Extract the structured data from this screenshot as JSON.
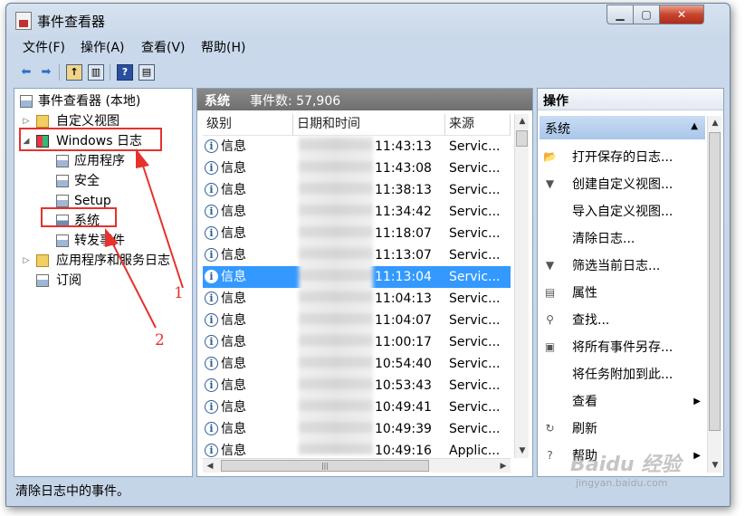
{
  "window": {
    "title": "事件查看器"
  },
  "menubar": {
    "items": [
      "文件(F)",
      "操作(A)",
      "查看(V)",
      "帮助(H)"
    ]
  },
  "tree": {
    "items": [
      {
        "label": "事件查看器 (本地)"
      },
      {
        "label": "自定义视图"
      },
      {
        "label": "Windows 日志"
      },
      {
        "label": "应用程序"
      },
      {
        "label": "安全"
      },
      {
        "label": "Setup"
      },
      {
        "label": "系统"
      },
      {
        "label": "转发事件"
      },
      {
        "label": "应用程序和服务日志"
      },
      {
        "label": "订阅"
      }
    ]
  },
  "center": {
    "title": "系统",
    "count_text": "事件数: 57,906",
    "columns": [
      "级别",
      "日期和时间",
      "来源"
    ],
    "rows": [
      {
        "level": "信息",
        "time": "11:43:13",
        "source": "Servic..."
      },
      {
        "level": "信息",
        "time": "11:43:08",
        "source": "Servic..."
      },
      {
        "level": "信息",
        "time": "11:38:13",
        "source": "Servic..."
      },
      {
        "level": "信息",
        "time": "11:34:42",
        "source": "Servic..."
      },
      {
        "level": "信息",
        "time": "11:18:07",
        "source": "Servic..."
      },
      {
        "level": "信息",
        "time": "11:13:07",
        "source": "Servic..."
      },
      {
        "level": "信息",
        "time": "11:13:04",
        "source": "Servic..."
      },
      {
        "level": "信息",
        "time": "11:04:13",
        "source": "Servic..."
      },
      {
        "level": "信息",
        "time": "11:04:07",
        "source": "Servic..."
      },
      {
        "level": "信息",
        "time": "11:00:17",
        "source": "Servic..."
      },
      {
        "level": "信息",
        "time": "10:54:40",
        "source": "Servic..."
      },
      {
        "level": "信息",
        "time": "10:53:43",
        "source": "Servic..."
      },
      {
        "level": "信息",
        "time": "10:49:41",
        "source": "Servic..."
      },
      {
        "level": "信息",
        "time": "10:49:39",
        "source": "Servic..."
      },
      {
        "level": "信息",
        "time": "10:49:16",
        "source": "Applic..."
      }
    ]
  },
  "actions": {
    "title": "操作",
    "section": "系统",
    "items": [
      {
        "label": "打开保存的日志...",
        "icon": "open-folder"
      },
      {
        "label": "创建自定义视图...",
        "icon": "filter"
      },
      {
        "label": "导入自定义视图...",
        "icon": ""
      },
      {
        "label": "清除日志...",
        "icon": ""
      },
      {
        "label": "筛选当前日志...",
        "icon": "filter"
      },
      {
        "label": "属性",
        "icon": "properties"
      },
      {
        "label": "查找...",
        "icon": "binoculars"
      },
      {
        "label": "将所有事件另存...",
        "icon": "save"
      },
      {
        "label": "将任务附加到此...",
        "icon": ""
      },
      {
        "label": "查看",
        "icon": ""
      },
      {
        "label": "刷新",
        "icon": "refresh"
      },
      {
        "label": "帮助",
        "icon": "help"
      }
    ]
  },
  "statusbar": {
    "text": "清除日志中的事件。"
  },
  "annotations": {
    "label_1": "1",
    "label_2": "2"
  },
  "watermark": {
    "text": "Baidu 经验",
    "sub": "jingyan.baidu.com"
  },
  "colors": {
    "selected_row": "#3399ff",
    "annotation": "#e5322d"
  }
}
